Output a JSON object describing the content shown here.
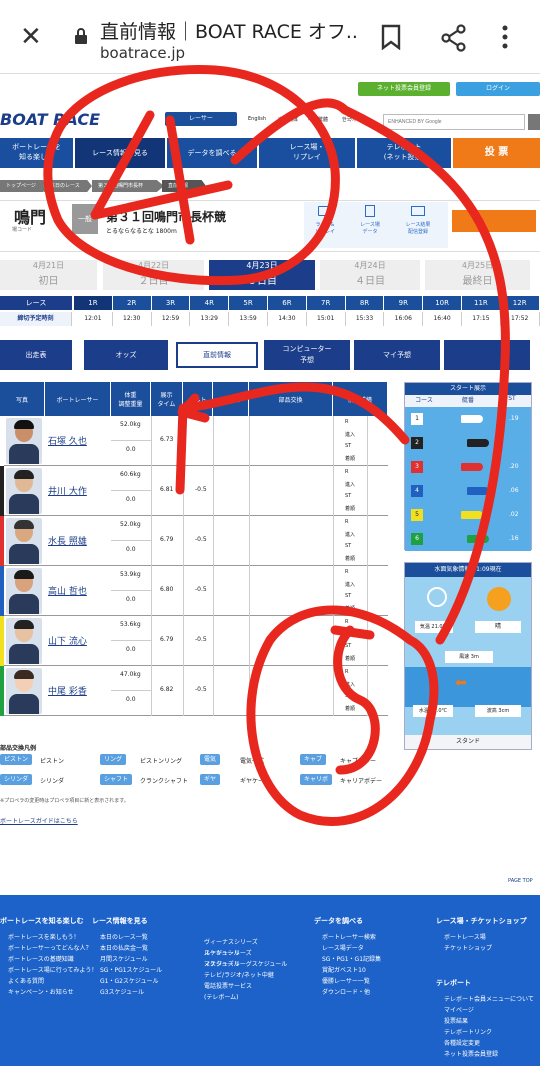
{
  "browser": {
    "title": "直前情報｜BOAT RACE オフ...",
    "url": "boatrace.jp"
  },
  "header": {
    "member_btn": "ネット投票会員登録",
    "login_btn": "ログイン",
    "logo": "BOAT RACE",
    "racer_btn": "レーサー",
    "langs": [
      "English",
      "中文简体",
      "中文繁體",
      "한국어"
    ],
    "search_placeholder": "ENHANCED BY Google"
  },
  "nav": {
    "items": [
      "ボートレースを\n知る楽しむ",
      "レース情報を見る",
      "データを調べる",
      "レース場・\nリプレイ",
      "テレボート\n(ネット投票)"
    ],
    "vote_btn": "投 票"
  },
  "breadcrumb": [
    "トップページ",
    "本日のレース",
    "第３１回鳴門市長杯",
    "直前情報"
  ],
  "venue": {
    "name": "鳴門",
    "sub": "場コード",
    "grade": "一般",
    "race_title": "第３１回鳴門市長杯競",
    "race_sub": "とるならなるとな 1800m",
    "links": [
      "ライブ&\nリプレイ",
      "レース場\nデータ",
      "レース結果\n配信登録"
    ]
  },
  "days": [
    {
      "date": "4月21日",
      "label": "初日"
    },
    {
      "date": "4月22日",
      "label": "２日目"
    },
    {
      "date": "4月23日",
      "label": "３日目"
    },
    {
      "date": "4月24日",
      "label": "４日目"
    },
    {
      "date": "4月25日",
      "label": "最終日"
    }
  ],
  "race_table": {
    "row1_label": "レース",
    "row2_label": "締切予定時刻",
    "races": [
      "1R",
      "2R",
      "3R",
      "4R",
      "5R",
      "6R",
      "7R",
      "8R",
      "9R",
      "10R",
      "11R",
      "12R"
    ],
    "times": [
      "12:01",
      "12:30",
      "12:59",
      "13:29",
      "13:59",
      "14:30",
      "15:01",
      "15:33",
      "16:06",
      "16:40",
      "17:15",
      "17:52"
    ]
  },
  "tabs": [
    "出走表",
    "オッズ",
    "直前情報",
    "コンピューター\n予想",
    "マイ予想"
  ],
  "entry_headers": [
    "写真",
    "ボートレーサー",
    "体重\n調整重量",
    "展示\nタイム",
    "チルト",
    "プロペラ",
    "部品交換",
    "前走成績"
  ],
  "racers": [
    {
      "lane": 1,
      "color": "#ffffff",
      "name": "石塚 久也",
      "weight": "52.0kg",
      "adjust": "0.0",
      "exhibit": "6.73",
      "tilt": "",
      "skin": "#c98f6a",
      "hair": "#111"
    },
    {
      "lane": 2,
      "color": "#222222",
      "name": "井川 大作",
      "weight": "60.6kg",
      "adjust": "0.0",
      "exhibit": "6.81",
      "tilt": "-0.5",
      "skin": "#e0b896",
      "hair": "#222"
    },
    {
      "lane": 3,
      "color": "#e03030",
      "name": "水長 照雄",
      "weight": "52.0kg",
      "adjust": "0.0",
      "exhibit": "6.79",
      "tilt": "-0.5",
      "skin": "#d9a880",
      "hair": "#333"
    },
    {
      "lane": 4,
      "color": "#2060c0",
      "name": "高山 哲也",
      "weight": "53.9kg",
      "adjust": "0.0",
      "exhibit": "6.80",
      "tilt": "-0.5",
      "skin": "#d7a27c",
      "hair": "#1a1a1a"
    },
    {
      "lane": 5,
      "color": "#f0e020",
      "name": "山下 流心",
      "weight": "53.6kg",
      "adjust": "0.0",
      "exhibit": "6.79",
      "tilt": "-0.5",
      "skin": "#e6c1a2",
      "hair": "#222"
    },
    {
      "lane": 6,
      "color": "#20a040",
      "name": "中尾 彩香",
      "weight": "47.0kg",
      "adjust": "0.0",
      "exhibit": "6.82",
      "tilt": "-0.5",
      "skin": "#f2cfb6",
      "hair": "#3a2a20"
    }
  ],
  "prev_labels": [
    "R",
    "進入",
    "ST",
    "着順"
  ],
  "start_panel": {
    "title": "スタート展示",
    "cols": [
      "コース",
      "艇番",
      "ST"
    ],
    "rows": [
      {
        "course": "1",
        "st": ".19"
      },
      {
        "course": "2",
        "st": ""
      },
      {
        "course": "3",
        "st": ".20"
      },
      {
        "course": "4",
        "st": ".06"
      },
      {
        "course": "5",
        "st": ".02"
      },
      {
        "course": "6",
        "st": ".16"
      }
    ]
  },
  "weather": {
    "title": "水面気象情報  11:09現在",
    "temp": "気温 21.0℃",
    "sky": "晴",
    "wind": "風速 3m",
    "water": "水温 15.0℃",
    "wave": "波高 3cm",
    "footer": "スタンド"
  },
  "parts_legend": {
    "title": "部品交換凡例",
    "items": [
      {
        "chip": "ピストン",
        "text": "ピストン"
      },
      {
        "chip": "リング",
        "text": "ピストンリング"
      },
      {
        "chip": "電気",
        "text": "電気一式"
      },
      {
        "chip": "キャブ",
        "text": "キャブレター"
      },
      {
        "chip": "シリンダ",
        "text": "シリンダ"
      },
      {
        "chip": "シャフト",
        "text": "クランクシャフト"
      },
      {
        "chip": "ギヤ",
        "text": "ギヤケース"
      },
      {
        "chip": "キャリボ",
        "text": "キャリアボデー"
      }
    ],
    "note": "※プロペラの変更時はプロペラ項目に新と表示されます。",
    "guide": "ボートレースガイドはこちら"
  },
  "page_top": "PAGE TOP",
  "footer": {
    "cols": [
      {
        "title": "ボートレースを知る楽しむ",
        "items": [
          "ボートレースを楽しもう！",
          "ボートレーサーってどんな人？",
          "ボートレースの基礎知識",
          "ボートレース場に行ってみよう！",
          "よくある質問",
          "キャンペーン・お知らせ"
        ]
      },
      {
        "title": "レース情報を見る",
        "items": [
          "本日のレース一覧",
          "本日の払戻金一覧",
          "月間スケジュール",
          "SG・PG1スケジュール",
          "G1・G2スケジュール",
          "G3スケジュール"
        ]
      },
      {
        "title": "",
        "items": [
          "ヴィーナスシリーズ\nスケジュール",
          "ルーキーシリーズ\nスケジュール",
          "マスターズリーグスケジュール",
          "テレビ/ラジオ/ネット中継",
          "電話投票サービス\n(テレボーム)"
        ]
      },
      {
        "title": "データを調べる",
        "items": [
          "ボートレーサー検索",
          "レース場データ",
          "SG・PG1・G1記録集",
          "賞配ガベスト10",
          "優勝レーサー一覧",
          "ダウンロード・他"
        ]
      },
      {
        "title": "レース場・チケットショップ",
        "items": [
          "ボートレース場",
          "チケットショップ"
        ]
      },
      {
        "title": "テレボート",
        "items": [
          "テレボート会員メニューについて",
          "マイページ",
          "投票結果",
          "テレボートリンク",
          "各種設定変更",
          "ネット投票会員登録"
        ]
      }
    ]
  },
  "annotations": {
    "label_a": "4",
    "label_b": "5",
    "color": "#e8281e"
  }
}
